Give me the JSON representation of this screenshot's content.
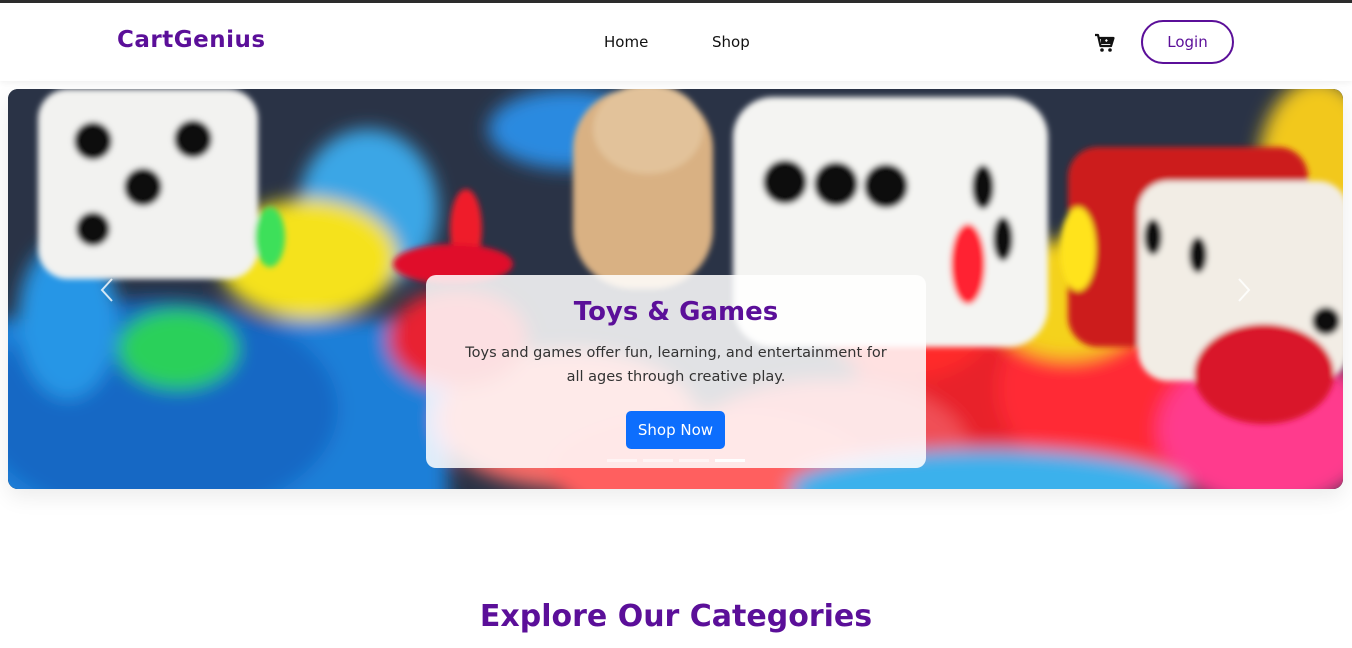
{
  "navbar": {
    "brand": "CartGenius",
    "links": [
      {
        "label": "Home"
      },
      {
        "label": "Shop"
      }
    ],
    "login_label": "Login",
    "cart_icon": "cart-icon"
  },
  "hero": {
    "title": "Toys & Games",
    "text": "Toys and games offer fun, learning, and entertainment for all ages through creative play.",
    "button_label": "Shop Now",
    "active_slide": 4,
    "slide_count": 4
  },
  "categories": {
    "title": "Explore Our Categories"
  },
  "colors": {
    "brand": "#5b0f99",
    "primary_button": "#0d6efd"
  }
}
